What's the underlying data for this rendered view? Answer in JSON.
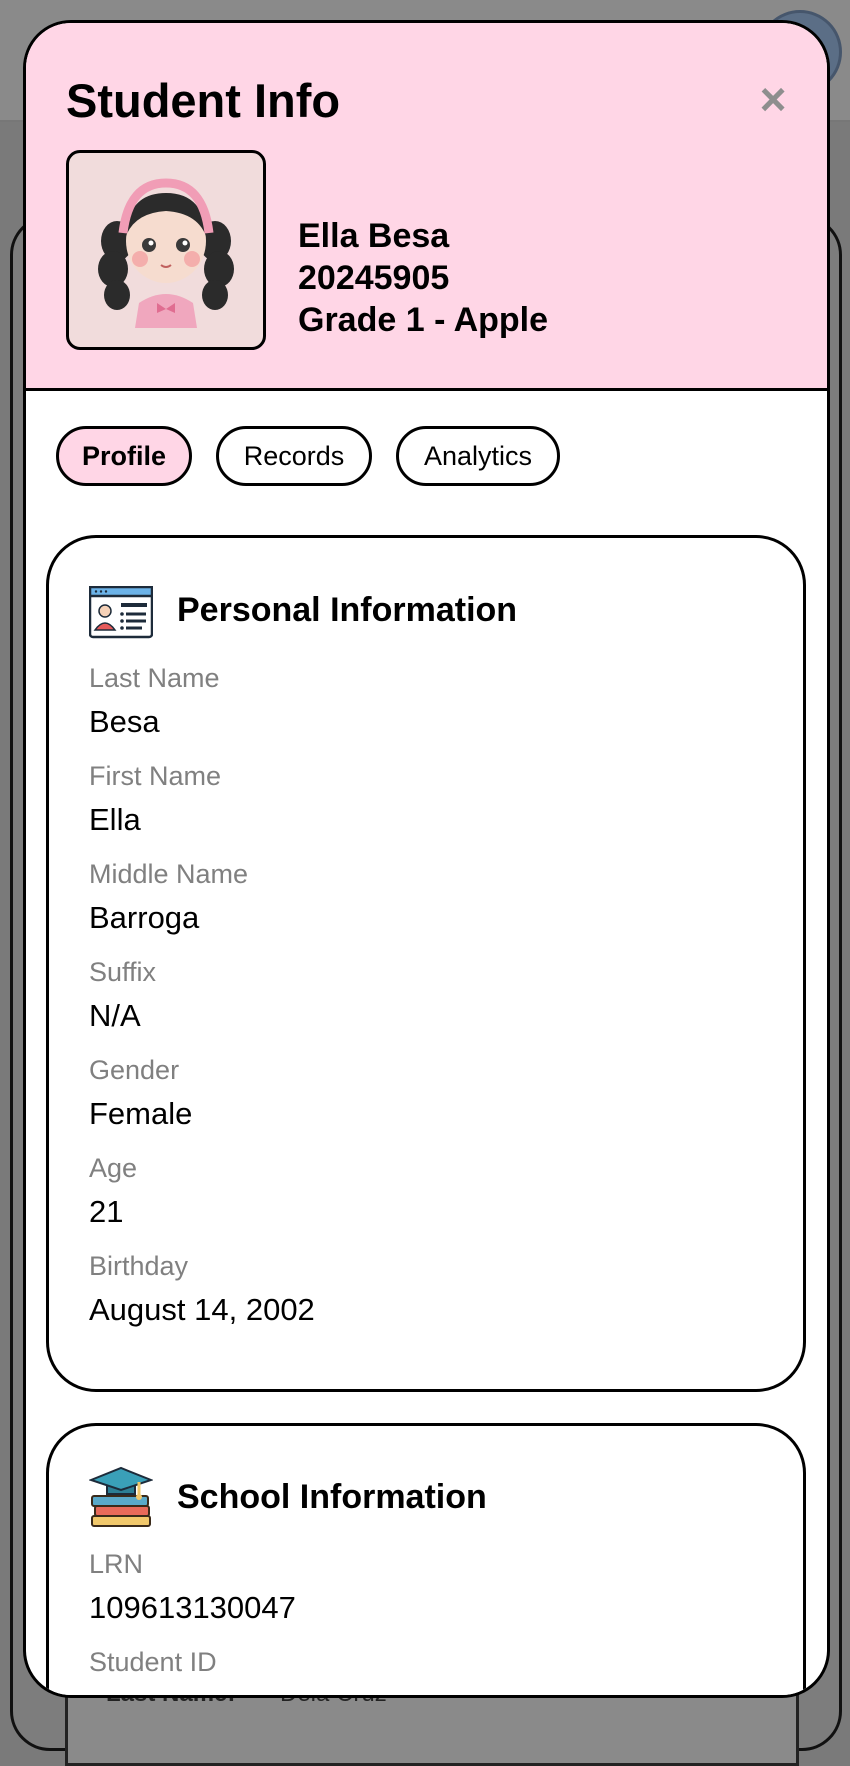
{
  "background": {
    "label": "Last Name:",
    "value": "Dela Cruz"
  },
  "modal": {
    "title": "Student Info",
    "close_icon": "×",
    "student": {
      "name": "Ella Besa",
      "id": "20245905",
      "section": "Grade 1 - Apple"
    },
    "tabs": [
      {
        "label": "Profile",
        "active": true
      },
      {
        "label": "Records",
        "active": false
      },
      {
        "label": "Analytics",
        "active": false
      }
    ],
    "personal": {
      "title": "Personal Information",
      "icon": "id-card-icon",
      "fields": [
        {
          "label": "Last Name",
          "value": "Besa"
        },
        {
          "label": "First Name",
          "value": "Ella"
        },
        {
          "label": "Middle Name",
          "value": "Barroga"
        },
        {
          "label": "Suffix",
          "value": "N/A"
        },
        {
          "label": "Gender",
          "value": "Female"
        },
        {
          "label": "Age",
          "value": "21"
        },
        {
          "label": "Birthday",
          "value": "August 14, 2002"
        }
      ]
    },
    "school": {
      "title": "School Information",
      "icon": "books-graduation-cap-icon",
      "fields": [
        {
          "label": "LRN",
          "value": "109613130047"
        },
        {
          "label": "Student ID",
          "value": ""
        }
      ]
    }
  },
  "colors": {
    "header_bg": "#ffd6e6",
    "overlay": "#7a7a7a",
    "label_gray": "#808080"
  }
}
